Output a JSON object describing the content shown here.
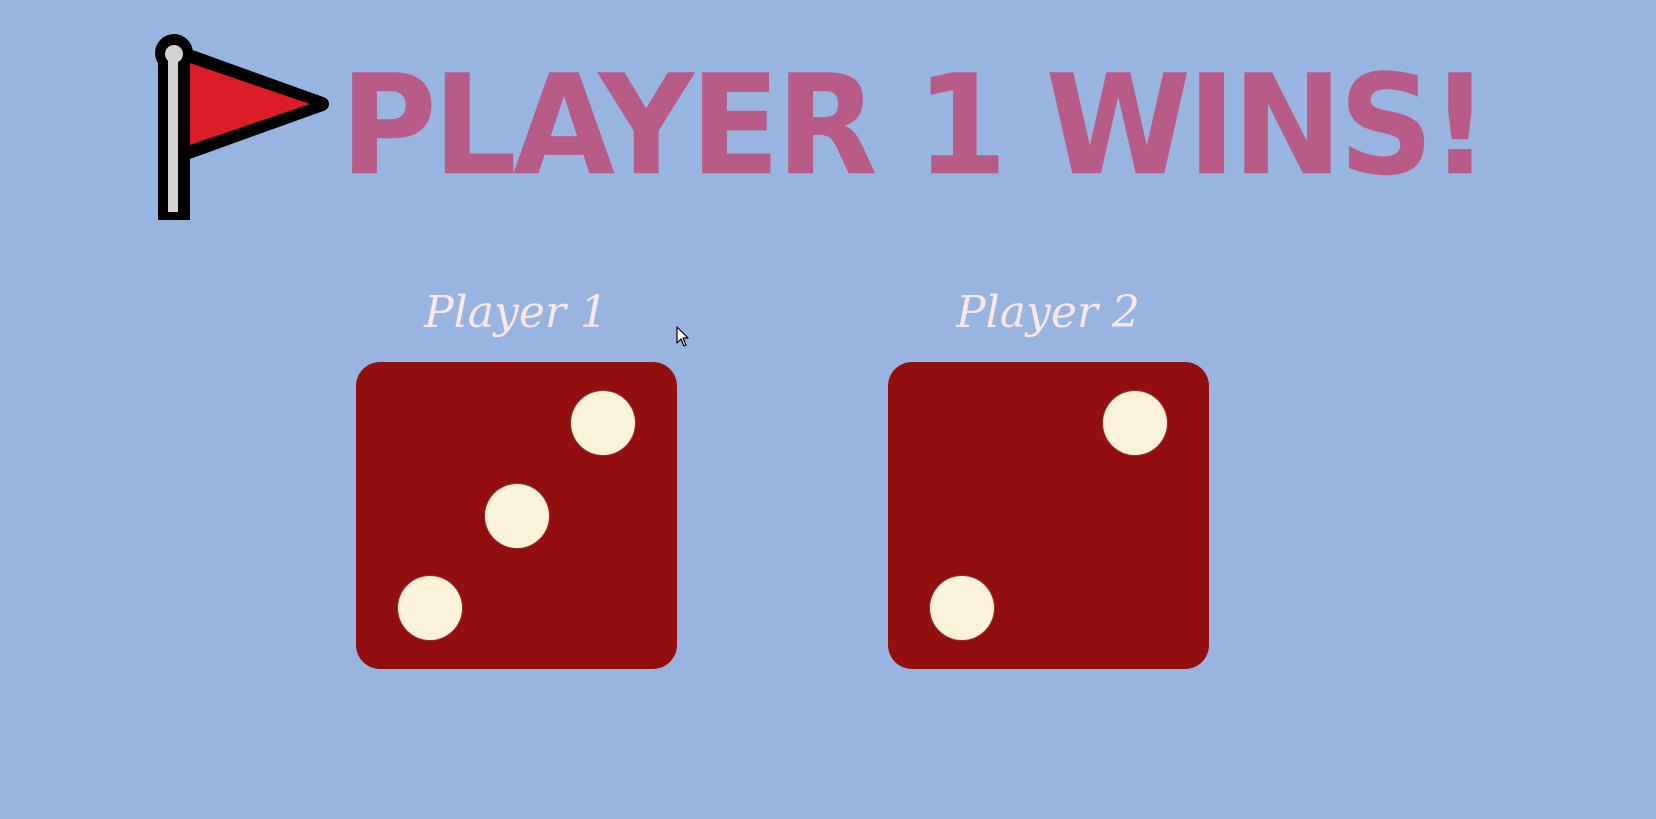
{
  "colors": {
    "background": "#98b4e0",
    "title": "#b85b87",
    "player_label": "#fbe6ea",
    "die_face": "#930e0f",
    "pip": "#faf2d9",
    "flag_red": "#dc1c27",
    "flag_outline": "#000000",
    "flag_pole": "#d2d2d2"
  },
  "banner": {
    "icon": "flag-icon",
    "text": "PLAYER 1 WINS!"
  },
  "players": [
    {
      "label": "Player 1",
      "die_value": 3
    },
    {
      "label": "Player 2",
      "die_value": 2
    }
  ]
}
